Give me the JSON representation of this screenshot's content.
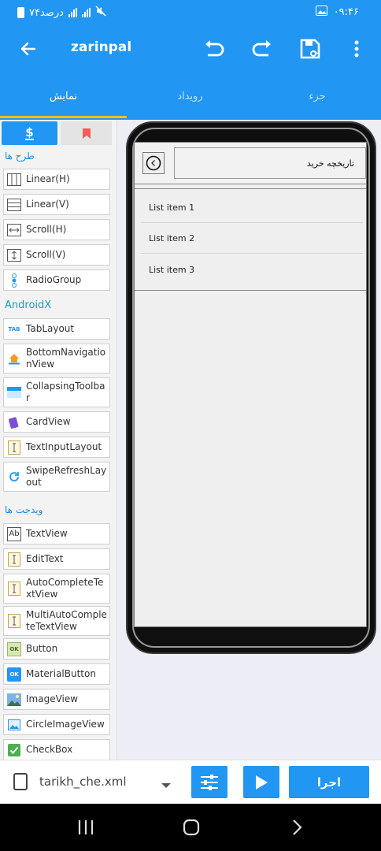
{
  "status": {
    "time": "۰۹:۴۶",
    "battery": "۷۴درصد"
  },
  "appbar": {
    "title": "zarinpal"
  },
  "tabs": [
    {
      "label": "نمایش"
    },
    {
      "label": "رویداد"
    },
    {
      "label": "جزء"
    }
  ],
  "palette": {
    "tab_a_symbol": "$",
    "sections": {
      "layouts": "طرح ها",
      "androidx": "AndroidX",
      "widgets": "ویدجت ها"
    },
    "items": [
      {
        "label": "Linear(H)",
        "icon": "linear-h-icon"
      },
      {
        "label": "Linear(V)",
        "icon": "linear-v-icon"
      },
      {
        "label": "Scroll(H)",
        "icon": "scroll-h-icon"
      },
      {
        "label": "Scroll(V)",
        "icon": "scroll-v-icon"
      },
      {
        "label": "RadioGroup",
        "icon": "radiogroup-icon"
      },
      {
        "label": "TabLayout",
        "icon": "tablayout-icon"
      },
      {
        "label": "BottomNavigationView",
        "icon": "bottom-navigation-icon"
      },
      {
        "label": "CollapsingToolbar",
        "icon": "collapsing-toolbar-icon"
      },
      {
        "label": "CardView",
        "icon": "cardview-icon"
      },
      {
        "label": "TextInputLayout",
        "icon": "textinput-layout-icon"
      },
      {
        "label": "SwipeRefreshLayout",
        "icon": "swipe-refresh-icon"
      },
      {
        "label": "TextView",
        "icon": "textview-icon"
      },
      {
        "label": "EditText",
        "icon": "edittext-icon"
      },
      {
        "label": "AutoCompleteTextView",
        "icon": "autocomplete-icon"
      },
      {
        "label": "MultiAutoCompleteTextView",
        "icon": "multi-autocomplete-icon"
      },
      {
        "label": "Button",
        "icon": "button-icon"
      },
      {
        "label": "MaterialButton",
        "icon": "material-button-icon"
      },
      {
        "label": "ImageView",
        "icon": "imageview-icon"
      },
      {
        "label": "CircleImageView",
        "icon": "circle-imageview-icon"
      },
      {
        "label": "CheckBox",
        "icon": "checkbox-icon"
      }
    ],
    "icon_texts": {
      "tab": "TAB",
      "ab": "Ab",
      "ok": "OK"
    }
  },
  "preview": {
    "title": "تاریخچه خرید",
    "list": [
      "List item 1",
      "List item 2",
      "List item 3"
    ]
  },
  "bottom": {
    "file": "tarikh_che.xml",
    "run_label": "اجرا"
  },
  "colors": {
    "primary": "#2196f3",
    "accent": "#ffc107"
  }
}
